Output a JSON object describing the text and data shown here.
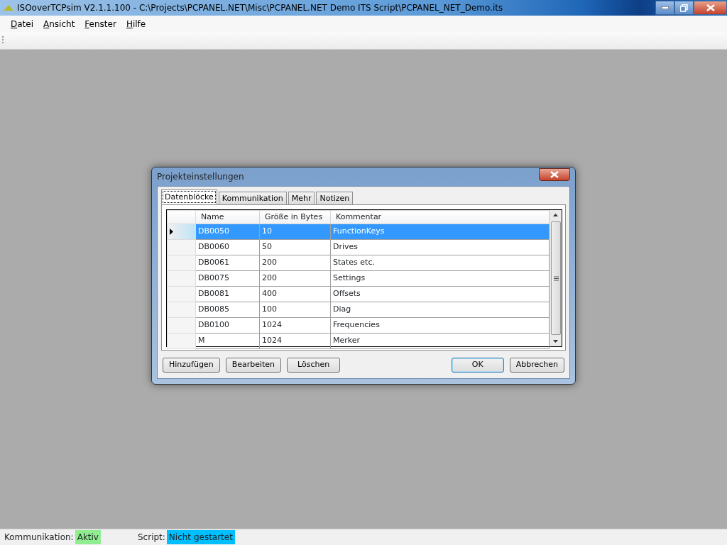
{
  "window": {
    "title": "ISOoverTCPsim V2.1.1.100 - C:\\Projects\\PCPANEL.NET\\Misc\\PCPANEL.NET Demo ITS Script\\PCPANEL_NET_Demo.its"
  },
  "menu": [
    "Datei",
    "Ansicht",
    "Fenster",
    "Hilfe"
  ],
  "dialog": {
    "title": "Projekteinstellungen",
    "tabs": [
      {
        "label": "Datenblöcke",
        "selected": true
      },
      {
        "label": "Kommunikation",
        "selected": false
      },
      {
        "label": "Mehr",
        "selected": false
      },
      {
        "label": "Notizen",
        "selected": false
      }
    ],
    "table": {
      "columns": [
        "Name",
        "Größe in Bytes",
        "Kommentar"
      ],
      "rows": [
        {
          "cells": [
            "DB0050",
            "10",
            "FunctionKeys"
          ],
          "selected": true
        },
        {
          "cells": [
            "DB0060",
            "50",
            "Drives"
          ],
          "selected": false
        },
        {
          "cells": [
            "DB0061",
            "200",
            "States etc."
          ],
          "selected": false
        },
        {
          "cells": [
            "DB0075",
            "200",
            "Settings"
          ],
          "selected": false
        },
        {
          "cells": [
            "DB0081",
            "400",
            "Offsets"
          ],
          "selected": false
        },
        {
          "cells": [
            "DB0085",
            "100",
            "Diag"
          ],
          "selected": false
        },
        {
          "cells": [
            "DB0100",
            "1024",
            "Frequencies"
          ],
          "selected": false
        },
        {
          "cells": [
            "M",
            "1024",
            "Merker"
          ],
          "selected": false
        }
      ]
    },
    "left_buttons": [
      "Hinzufügen",
      "Bearbeiten",
      "Löschen"
    ],
    "right_buttons": [
      {
        "label": "OK",
        "default": true
      },
      {
        "label": "Abbrechen",
        "default": false
      }
    ]
  },
  "status_bar": [
    {
      "label": "Kommunikation:",
      "value": "Aktiv",
      "color": "#90ee90"
    },
    {
      "label": "Script:",
      "value": "Nicht gestartet",
      "color": "#00bfff"
    }
  ]
}
